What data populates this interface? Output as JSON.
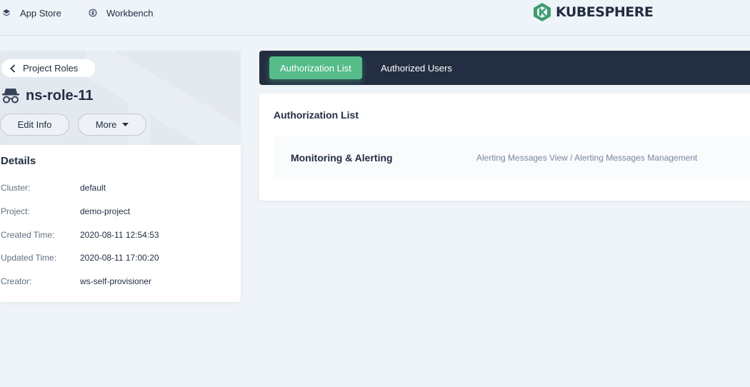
{
  "topbar": {
    "nav": [
      {
        "label": "App Store",
        "icon": "layers-icon"
      },
      {
        "label": "Workbench",
        "icon": "dashboard-icon"
      }
    ],
    "logo_text": "KUBESPHERE",
    "logo_color": "#3e9d71"
  },
  "role": {
    "back_label": "Project Roles",
    "name": "ns-role-11",
    "edit_label": "Edit Info",
    "more_label": "More"
  },
  "details": {
    "title": "Details",
    "rows": [
      {
        "key": "Cluster:",
        "value": "default"
      },
      {
        "key": "Project:",
        "value": "demo-project"
      },
      {
        "key": "Created Time:",
        "value": "2020-08-11 12:54:53"
      },
      {
        "key": "Updated Time:",
        "value": "2020-08-11 17:00:20"
      },
      {
        "key": "Creator:",
        "value": "ws-self-provisioner"
      }
    ]
  },
  "tabs": [
    {
      "label": "Authorization List",
      "active": true
    },
    {
      "label": "Authorized Users",
      "active": false
    }
  ],
  "authorization": {
    "title": "Authorization List",
    "items": [
      {
        "group": "Monitoring & Alerting",
        "permissions": "Alerting Messages View / Alerting Messages Management"
      }
    ]
  },
  "colors": {
    "accent": "#55bc8a",
    "dark": "#242e42",
    "background": "#eff4f9"
  }
}
